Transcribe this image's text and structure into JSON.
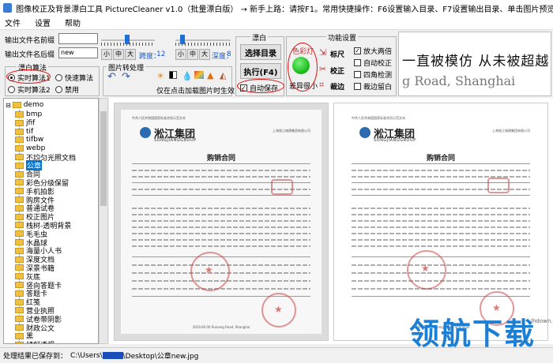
{
  "window": {
    "title": "图像校正及背景漂白工具 PictureCleaner v1.0（批量漂白版） → 新手上路：请按F1。常用快捷操作：F6设置输入目录、F7设置输出目录、单击图片预览结果、F5..."
  },
  "menu": [
    "文件",
    "设置",
    "帮助"
  ],
  "output": {
    "prefix_label": "输出文件名前缀",
    "prefix_value": "",
    "suffix_label": "输出文件名后缀",
    "suffix_value": "new"
  },
  "sliders": {
    "small": "小",
    "medium": "中",
    "large": "大",
    "span_label": "跨度：",
    "span_value": "12",
    "depth_label": "深度：",
    "depth_value": "8"
  },
  "bleach_algo": {
    "title": "漂白算法",
    "options": [
      "实时算法1",
      "快速算法",
      "实时算法2",
      "禁用"
    ],
    "selected": "实时算法1"
  },
  "image_ops": {
    "title": "图片转处理",
    "hint": "仅在点击加载图片时生效"
  },
  "bleach": {
    "title": "漂白",
    "select_dir": "选择目录",
    "execute": "执行(F4)",
    "auto_save": "自动保存",
    "auto_save_checked": true
  },
  "features": {
    "title": "功能设置",
    "color_light_label": "色彩灯",
    "diff_label": "差异很小",
    "buttons": [
      "标尺",
      "校正",
      "裁边"
    ],
    "checks": [
      {
        "label": "放大两倍",
        "checked": true
      },
      {
        "label": "自动校正",
        "checked": false
      },
      {
        "label": "四角检测",
        "checked": false
      },
      {
        "label": "裁边留白",
        "checked": false
      }
    ]
  },
  "preview": {
    "line1": "一直被模仿 从未被超越",
    "line2": "g Road, Shanghai"
  },
  "tree": {
    "root": "demo",
    "items": [
      "bmp",
      "jfif",
      "tif",
      "tifbw",
      "webp",
      "不均匀光照文档",
      "公章",
      "合同",
      "彩色分级保留",
      "手机拍影",
      "购房文件",
      "普通试卷",
      "校正图片",
      "栈树-透明背景",
      "毛毛虫",
      "水晶球",
      "海量小人书",
      "深度文档",
      "深景书籍",
      "灰底",
      "竖向答题卡",
      "答题卡",
      "红笺",
      "营业执照",
      "试卷带阴影",
      "财政公文",
      "黑",
      "倾斜透视"
    ],
    "selected": "公章"
  },
  "document": {
    "header": "中共人民共和国国家标准合同示范文本",
    "company_right": "上海淞江城建集团有限公司",
    "logo_text": "淞江集团",
    "logo_sub": "SONGJIANGGROUP",
    "title": "购销合同",
    "footer": "2019.06.00 Ruixang Road, Shanghai"
  },
  "watermark": {
    "text": "领航下载",
    "site": "lhdown.com"
  },
  "status": {
    "prefix": "处理结果已保存到：",
    "path_start": "C:\\Users\\",
    "path_end": "\\Desktop\\公章new.jpg"
  },
  "colors": {
    "accent": "#1a57c9",
    "highlight": "#e01010",
    "green_light": "#22c022"
  }
}
